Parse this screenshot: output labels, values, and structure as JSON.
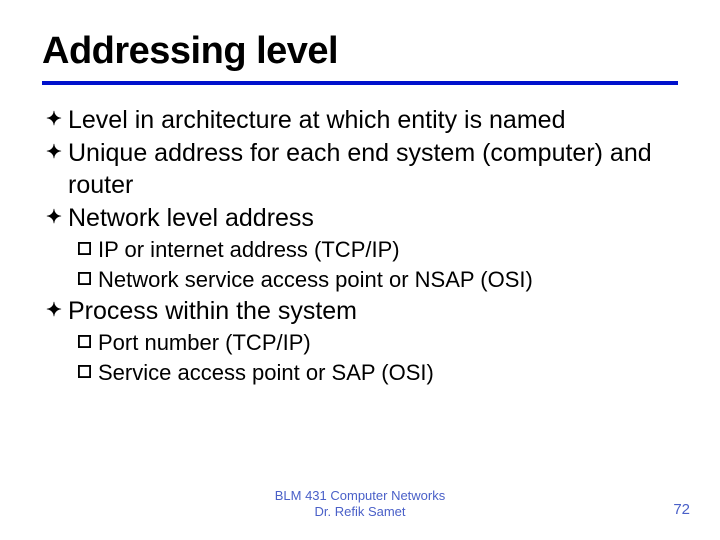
{
  "title": "Addressing level",
  "bullets": {
    "b0": "Level in architecture at which entity is named",
    "b1": "Unique address for each end system (computer) and router",
    "b2": "Network level address",
    "b2s0": "IP or internet address (TCP/IP)",
    "b2s1": "Network service access point or NSAP (OSI)",
    "b3": "Process within the system",
    "b3s0": "Port number (TCP/IP)",
    "b3s1": "Service access point or SAP (OSI)"
  },
  "footer": {
    "line1": "BLM 431 Computer Networks",
    "line2": "Dr. Refik Samet"
  },
  "page": "72"
}
